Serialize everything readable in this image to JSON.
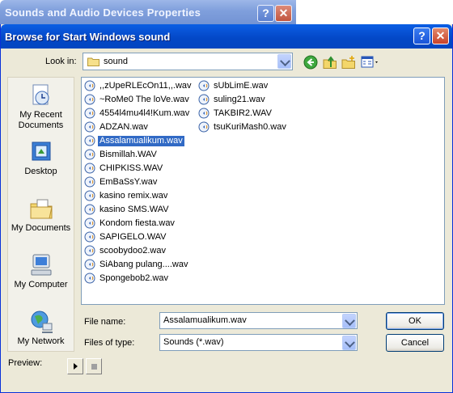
{
  "parent_window": {
    "title": "Sounds and Audio Devices Properties",
    "help": "?",
    "close": "✕"
  },
  "dialog": {
    "title": "Browse for Start Windows sound",
    "help": "?",
    "close": "✕",
    "look_in_label": "Look in:",
    "look_in_value": "sound"
  },
  "places": [
    {
      "label": "My Recent Documents",
      "icon": "recent-documents-icon"
    },
    {
      "label": "Desktop",
      "icon": "desktop-icon"
    },
    {
      "label": "My Documents",
      "icon": "my-documents-icon"
    },
    {
      "label": "My Computer",
      "icon": "my-computer-icon"
    },
    {
      "label": "My Network",
      "icon": "my-network-icon"
    }
  ],
  "files": {
    "column1": [
      ",,zUpeRLEcOn11,,.wav",
      "~RoMe0 The loVe.wav",
      "4554l4mu4l4!Kum.wav",
      "ADZAN.wav",
      "Assalamualikum.wav",
      "Bismillah.WAV",
      "CHIPKISS.WAV",
      "EmBaSsY.wav",
      "kasino remix.wav",
      "kasino SMS.WAV",
      "Kondom fiesta.wav",
      "SAPIGELO.WAV",
      "scoobydoo2.wav",
      "SiAbang pulang....wav",
      "Spongebob2.wav"
    ],
    "column2": [
      "sUbLimE.wav",
      "suling21.wav",
      "TAKBIR2.WAV",
      "tsuKuriMash0.wav"
    ],
    "selected": "Assalamualikum.wav"
  },
  "form": {
    "file_name_label": "File name:",
    "file_name_value": "Assalamualikum.wav",
    "files_of_type_label": "Files of type:",
    "files_of_type_value": "Sounds (*.wav)",
    "ok": "OK",
    "cancel": "Cancel",
    "preview_label": "Preview:"
  },
  "colors": {
    "titlebar": "#0347c6",
    "selection": "#316ac5",
    "dialog_bg": "#ece9d8"
  }
}
